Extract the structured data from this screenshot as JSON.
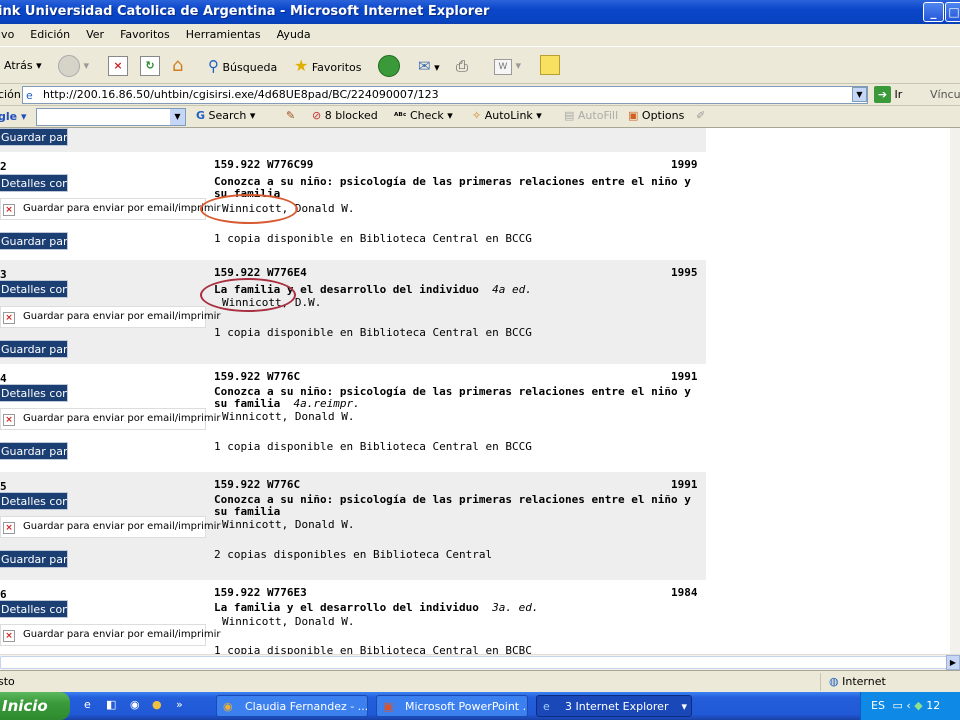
{
  "window": {
    "title": "ink Universidad Catolica de Argentina - Microsoft Internet Explorer"
  },
  "menu": [
    "ivo",
    "Edición",
    "Ver",
    "Favoritos",
    "Herramientas",
    "Ayuda"
  ],
  "toolbar": {
    "back": "Atrás",
    "search": "Búsqueda",
    "favorites": "Favoritos"
  },
  "address": {
    "label": "ción",
    "url": "http://200.16.86.50/uhtbin/cgisirsi.exe/4d68UE8pad/BC/224090007/123",
    "go": "Ir",
    "links": "Víncul"
  },
  "google": {
    "logo": "gle",
    "search": "Search",
    "blocked": "8 blocked",
    "check": "Check",
    "autolink": "AutoLink",
    "autofill": "AutoFill",
    "options": "Options"
  },
  "buttons": {
    "save": "Guardar par",
    "details": "Detalles con",
    "save_email": "Guardar para enviar por email/imprimir"
  },
  "records": [
    {
      "num": "2",
      "call": "159.922 W776C99",
      "year": "1999",
      "title": "Conozca a su niño: psicología de las primeras relaciones entre el niño y su familia",
      "edition": "",
      "author": "Winnicott, Donald W.",
      "avail": "1 copia disponible en Biblioteca Central en BCCG"
    },
    {
      "num": "3",
      "call": "159.922 W776E4",
      "year": "1995",
      "title": "La familia y el desarrollo del individuo",
      "edition": "4a ed.",
      "author": "Winnicott, D.W.",
      "avail": "1 copia disponible en Biblioteca Central en BCCG"
    },
    {
      "num": "4",
      "call": "159.922 W776C",
      "year": "1991",
      "title": "Conozca a su niño: psicología de las primeras relaciones entre el niño y su familia",
      "edition": "4a.reimpr.",
      "author": "Winnicott, Donald W.",
      "avail": "1 copia disponible en Biblioteca Central en BCCG"
    },
    {
      "num": "5",
      "call": "159.922 W776C",
      "year": "1991",
      "title": "Conozca a su niño: psicología de las primeras relaciones entre el niño y su familia",
      "edition": "",
      "author": "Winnicott, Donald W.",
      "avail": "2 copias disponibles en Biblioteca Central"
    },
    {
      "num": "6",
      "call": "159.922 W776E3",
      "year": "1984",
      "title": "La familia y el desarrollo del individuo",
      "edition": "3a. ed.",
      "author": "Winnicott, Donald W.",
      "avail": "1 copia disponible en Biblioteca Central en BCBC"
    }
  ],
  "status": {
    "left": "sto",
    "zone": "Internet"
  },
  "taskbar": {
    "start": "Inicio",
    "tasks": [
      "Claudia Fernandez - ...",
      "Microsoft PowerPoint ...",
      "3 Internet Explorer"
    ],
    "lang": "ES",
    "clock": "12"
  }
}
